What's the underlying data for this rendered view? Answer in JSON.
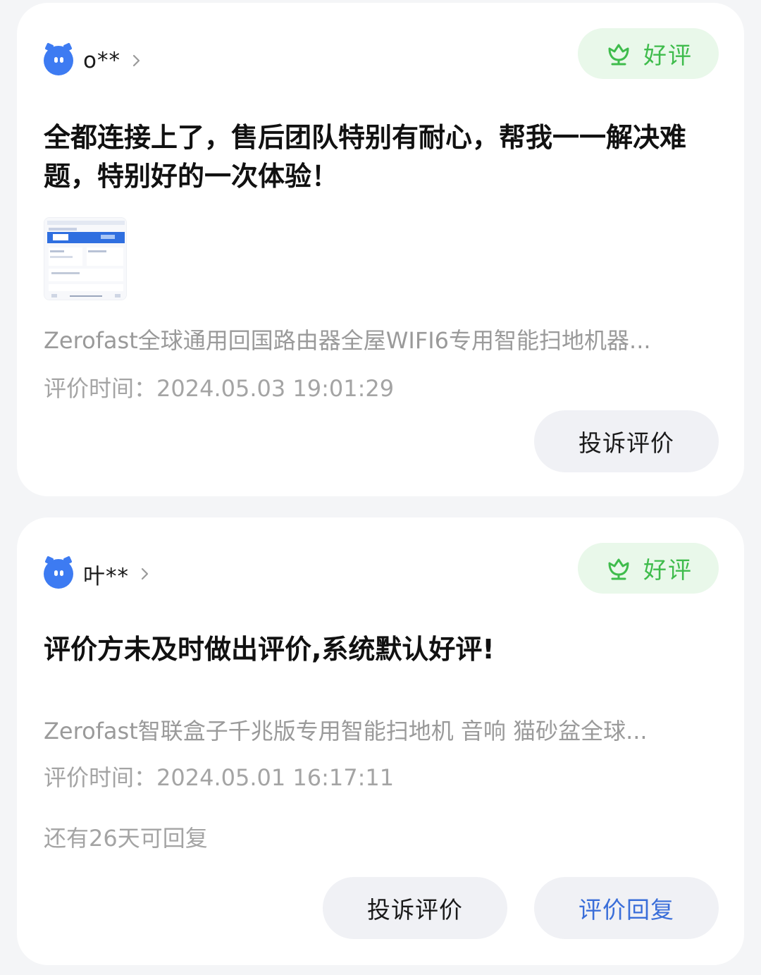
{
  "reviews": [
    {
      "user_name": "o**",
      "badge_label": "好评",
      "text": "全都连接上了，售后团队特别有耐心，帮我一一解决难题，特别好的一次体验！",
      "has_image": true,
      "product": "Zerofast全球通用回国路由器全屋WIFI6专用智能扫地机器...",
      "review_time": "评价时间：2024.05.03 19:01:29",
      "complain_label": "投诉评价"
    },
    {
      "user_name": "叶**",
      "badge_label": "好评",
      "text": "评价方未及时做出评价,系统默认好评!",
      "has_image": false,
      "product": "Zerofast智联盒子千兆版专用智能扫地机 音响 猫砂盆全球...",
      "review_time": "评价时间：2024.05.01 16:17:11",
      "reply_remaining": "还有26天可回复",
      "complain_label": "投诉评价",
      "reply_label": "评价回复"
    }
  ],
  "colors": {
    "avatar": "#3d7bf2",
    "badge_bg": "#e9f8ea",
    "badge_text": "#3fbc4c",
    "reply_button_text": "#3a6ed9"
  },
  "icons": {
    "avatar": "cat-avatar-icon",
    "chevron": "chevron-right-icon",
    "badge": "flower-icon"
  }
}
